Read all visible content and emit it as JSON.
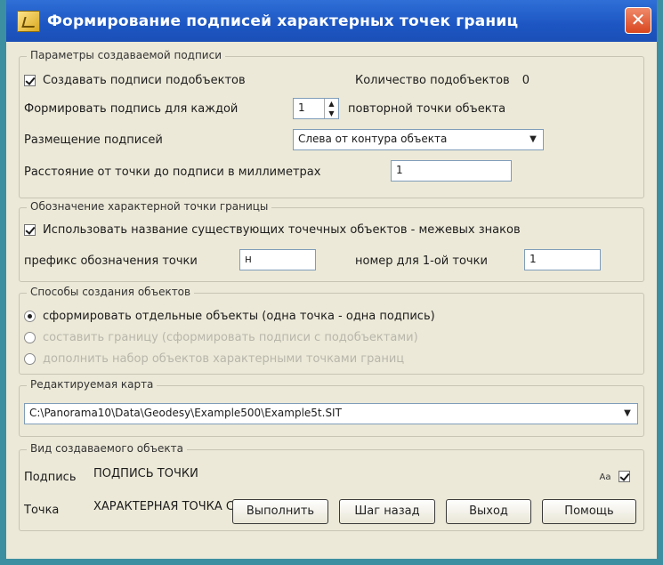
{
  "window": {
    "title": "Формирование подписей характерных точек границ",
    "close_glyph": "✕"
  },
  "params": {
    "legend": "Параметры создаваемой подписи",
    "create_sub_labels": "Создавать подписи подобъектов",
    "sub_count_label": "Количество подобъектов",
    "sub_count_value": "0",
    "form_label_for_each": "Формировать подпись для каждой",
    "each_value": "1",
    "each_suffix": "повторной точки объекта",
    "placement_label": "Размещение подписей",
    "placement_value": "Слева от контура объекта",
    "distance_label": "Расстояние от точки до подписи в миллиметрах",
    "distance_value": "1"
  },
  "designation": {
    "legend": "Обозначение характерной точки границы",
    "use_names_label": "Использовать название существующих точечных объектов - межевых знаков",
    "prefix_label": "префикс обозначения точки",
    "prefix_value": "н",
    "first_number_label": "номер для 1-ой точки",
    "first_number_value": "1"
  },
  "methods": {
    "legend": "Способы создания объектов",
    "option1": "сформировать отдельные объекты (одна точка - одна подпись)",
    "option2": "составить границу (сформировать подписи с подобъектами)",
    "option3": "дополнить набор объектов характерными точками границ"
  },
  "map": {
    "legend": "Редактируемая карта",
    "path": "C:\\Panorama10\\Data\\Geodesy\\Example500\\Example5t.SIT"
  },
  "object_type": {
    "legend": "Вид создаваемого объекта",
    "label_caption": "Подпись",
    "label_value": "ПОДПИСЬ ТОЧКИ",
    "label_icon_text": "Aa",
    "point_caption": "Точка",
    "point_value": "ХАРАКТЕРНАЯ ТОЧКА СУЩ ОДНОЗНАЧ"
  },
  "buttons": {
    "execute": "Выполнить",
    "step_back": "Шаг назад",
    "exit": "Выход",
    "help": "Помощь"
  }
}
